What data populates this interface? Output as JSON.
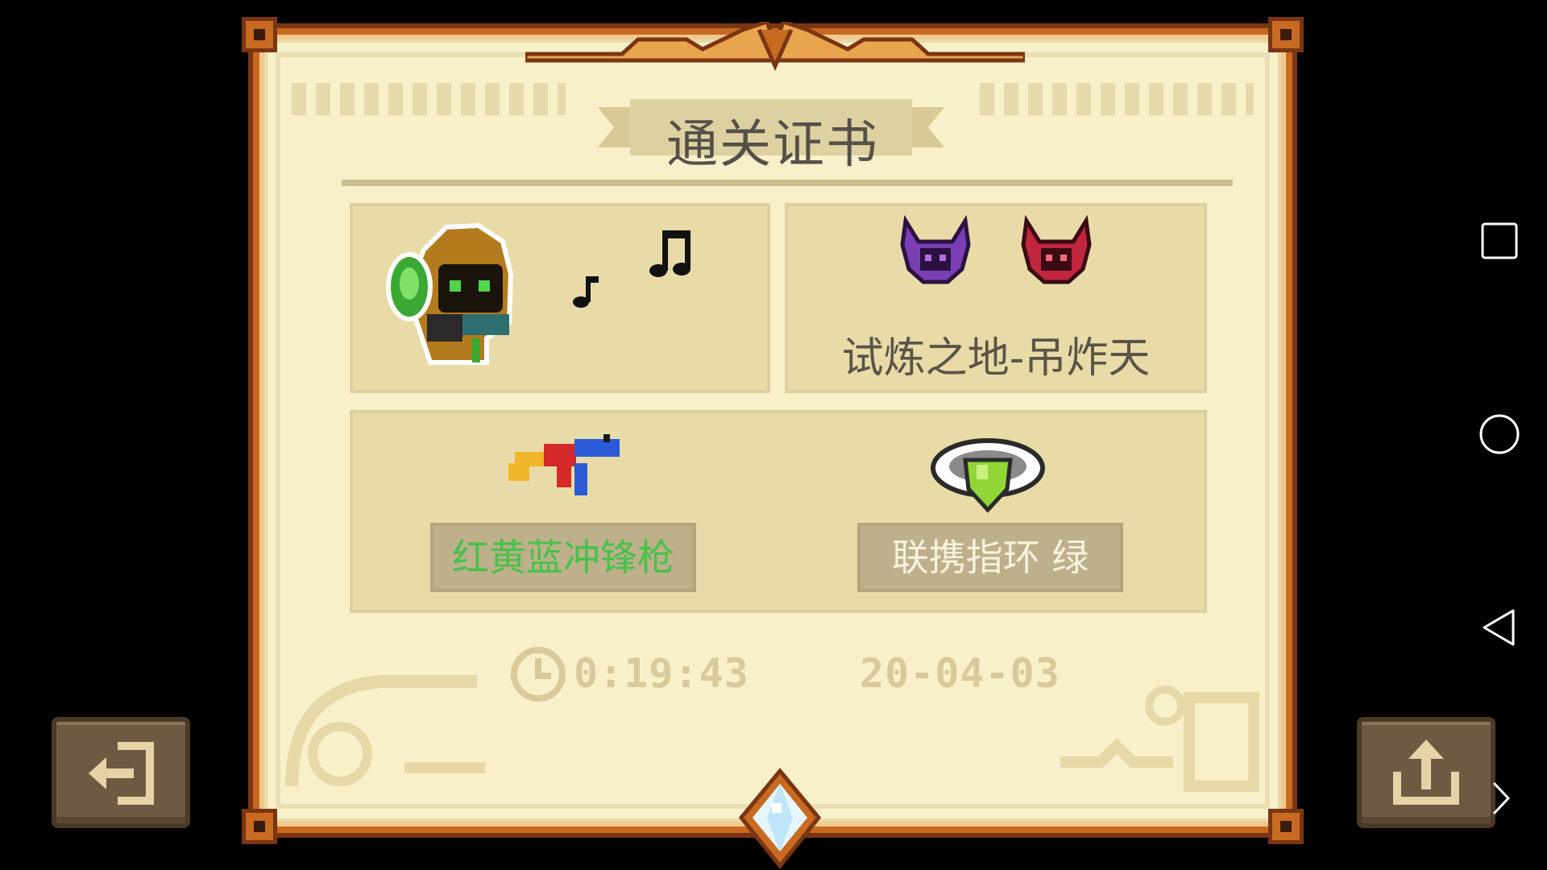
{
  "certificate": {
    "title": "通关证书",
    "hero": {
      "name_icon": "hooded-bard-hero-icon"
    },
    "level": {
      "name": "试炼之地-吊炸天"
    },
    "weapon": {
      "name": "红黄蓝冲锋枪",
      "color": "#46c24a"
    },
    "buff": {
      "name": "联携指环 绿",
      "color": "#f7f2de"
    },
    "time": "0:19:43",
    "date": "20-04-03"
  },
  "buttons": {
    "exit_icon": "exit-icon",
    "share_icon": "share-icon"
  },
  "android_nav": [
    "recent-apps-icon",
    "home-icon",
    "back-icon",
    "chevron-right-icon"
  ],
  "colors": {
    "frame": "#c86a22",
    "paper": "#f8f0c9",
    "panel": "#e8dba7",
    "button": "#6e5a42"
  }
}
